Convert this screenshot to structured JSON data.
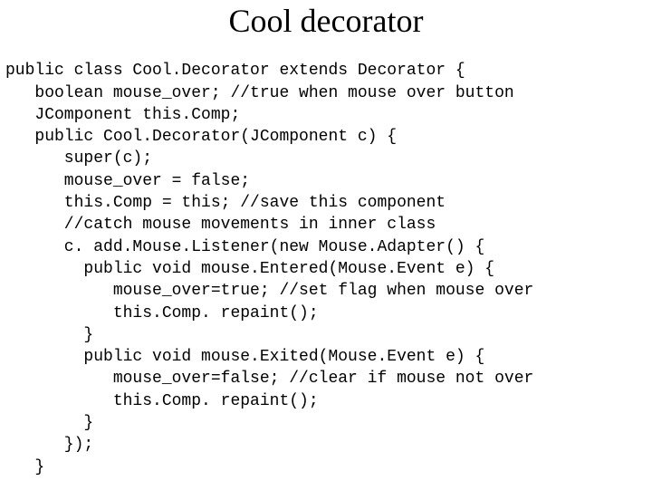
{
  "title": "Cool decorator",
  "code_lines": [
    "public class Cool.Decorator extends Decorator {",
    "   boolean mouse_over; //true when mouse over button",
    "   JComponent this.Comp;",
    "   public Cool.Decorator(JComponent c) {",
    "      super(c);",
    "      mouse_over = false;",
    "      this.Comp = this; //save this component",
    "      //catch mouse movements in inner class",
    "      c. add.Mouse.Listener(new Mouse.Adapter() {",
    "        public void mouse.Entered(Mouse.Event e) {",
    "           mouse_over=true; //set flag when mouse over",
    "           this.Comp. repaint();",
    "        }",
    "        public void mouse.Exited(Mouse.Event e) {",
    "           mouse_over=false; //clear if mouse not over",
    "           this.Comp. repaint();",
    "        }",
    "      });",
    "   }"
  ]
}
